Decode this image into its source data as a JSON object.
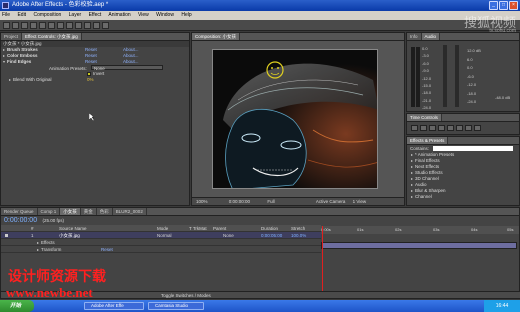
{
  "window": {
    "title": "Adobe After Effects - 色彩校验.aep *",
    "min": "_",
    "max": "□",
    "close": "×"
  },
  "menu": [
    "File",
    "Edit",
    "Composition",
    "Layer",
    "Effect",
    "Animation",
    "View",
    "Window",
    "Help"
  ],
  "project_panel": {
    "tabs": [
      "Project",
      "Effect Controls: 小女孩.jpg"
    ],
    "header": "小女孩 * 小女孩.jpg",
    "effects": [
      {
        "name": "Brush Strokes",
        "reset": "Reset",
        "about": "About..."
      },
      {
        "name": "Color Emboss",
        "reset": "Reset",
        "about": "About..."
      },
      {
        "name": "Find Edges",
        "reset": "Reset",
        "about": "About..."
      }
    ],
    "animation_presets_label": "Animation Presets:",
    "animation_presets_value": "None",
    "invert_label": "Invert",
    "blend_label": "Blend With Original",
    "blend_value": "0%"
  },
  "comp_panel": {
    "tab": "Composition: 小女孩",
    "zoom": "100%",
    "timecode": "0:00:00:00",
    "resolution": "Full",
    "camera": "Active Camera",
    "views": "1 View"
  },
  "info_panel": {
    "tabs": [
      "Info",
      "Audio"
    ],
    "right_labels": [
      "0.0",
      "-3.0",
      "-6.0",
      "-9.0",
      "-12.0",
      "-15.0",
      "-18.0",
      "-21.0",
      "-24.0"
    ],
    "left_labels": [
      "12.0 dB",
      "6.0",
      "0.0",
      "-6.0",
      "-12.0",
      "-18.0",
      "-24.0"
    ],
    "db_label": "-48.0 dB"
  },
  "time_controls": {
    "tab": "Time Controls"
  },
  "effects_presets": {
    "tab": "Effects & Presets",
    "contains_label": "Contains:",
    "items": [
      "* Animation Presets",
      "Final Effects",
      "Next Effects",
      "Studio Effects",
      "3D Channel",
      "Audio",
      "Blur & Sharpen",
      "Channel"
    ]
  },
  "timeline": {
    "tabs": [
      "Render Queue",
      "Comp 1",
      "小女孩",
      "黄金",
      "色彩",
      "BLUR2_0002"
    ],
    "timecode": "0:00:00:00",
    "fps": "(25.00 fps)",
    "columns": [
      "#",
      "Source Name",
      "Mode",
      "T TrkMat",
      "Parent",
      "Duration",
      "Stretch"
    ],
    "layer": {
      "num": "1",
      "name": "小女孩.jpg",
      "mode": "Normal",
      "parent": "None",
      "duration": "0:00:05:00",
      "stretch": "100.0%"
    },
    "sub_rows": [
      {
        "label": "Effects",
        "value": ""
      },
      {
        "label": "Transform",
        "value": "Reset"
      }
    ],
    "ruler": [
      "0:00s",
      "01s",
      "02s",
      "03s",
      "04s",
      "05s"
    ],
    "status": "Toggle Switches / Modes"
  },
  "watermarks": {
    "site_top": "搜狐视频",
    "site_top_url": "tv.sohu.com",
    "cn": "设计师资源下载",
    "url": "www.newbe.net"
  },
  "taskbar": {
    "start": "开始",
    "items": [
      "Adobe After Effe",
      "Camtasia Studio"
    ],
    "clock": "16:44"
  }
}
